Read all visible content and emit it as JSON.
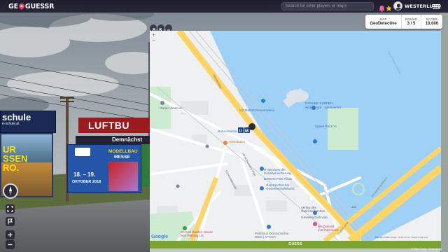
{
  "app": {
    "logo_left": "GE",
    "logo_right": "GUESSR",
    "search_placeholder": "Search for other players or maps",
    "username": "WESTERLUND"
  },
  "status": {
    "map_label": "MAP",
    "map_value": "GeoDetective",
    "round_label": "ROUND",
    "round_value": "3 / 5",
    "score_label": "SCORE",
    "score_value": "10,000"
  },
  "street": {
    "sign_schule": "schule",
    "sign_schule_url": "e-schule.at",
    "sign_luftbu": "LUFTBU",
    "sign_demnachst": "Demnächst",
    "sign_ur": "UR",
    "sign_essen": "SSEN",
    "sign_ro": "RO.",
    "sign_modellbau": "MODELLBAU",
    "sign_messe": "MESSE",
    "sign_dates": "18. – 19.",
    "sign_month": "OKTOBER 2018"
  },
  "map": {
    "labels": {
      "handelskai": "Handelskai",
      "ud_station": "U2 Station Donaumarina",
      "gerlach": "Garten Zentrum",
      "danube": "DANUBE SURFER",
      "danube2": "Wakeboard · Sportverein",
      "spider": "Spider Rock XI",
      "donaumarina": "Donaumarina",
      "arevolution": "Arevolution",
      "it_services": "IT-Services der",
      "it_services2": "Sozialversicherung",
      "bawag": "BAWAG PSK Filiale",
      "oegb": "Österreichischer",
      "oegb2": "Gewerkschaftsbund",
      "jakob": "Jakob-Reumann-Platz",
      "donaustadt": "Donaustadtstraße",
      "verlag": "Verlag des",
      "verlag2": "Österreichischen ...",
      "gewerkschaft": "Gewerkschaft vida",
      "parkhaus": "Parkhaus Donaumarina",
      "parkhaus2": "Wien | APCOA",
      "be_catered": "Be Catered",
      "be_catered2": "event services",
      "garden_house": "Central Garden House",
      "garden_house2": "with Parking Lot",
      "prater": "Praterbrücke",
      "donaubrucke": "Donauuferautobahn",
      "a22": "A22",
      "radweg": "Donaukanal-Radweg",
      "u_badge": "U",
      "m_badge": "M",
      "google": "Google",
      "attribution": "Map data ©2021 Google · Terms of Use · Report a map error"
    },
    "guess_label": "GUESS"
  },
  "footer": {
    "google_small": "© 2021 Google · Terms of Use"
  }
}
